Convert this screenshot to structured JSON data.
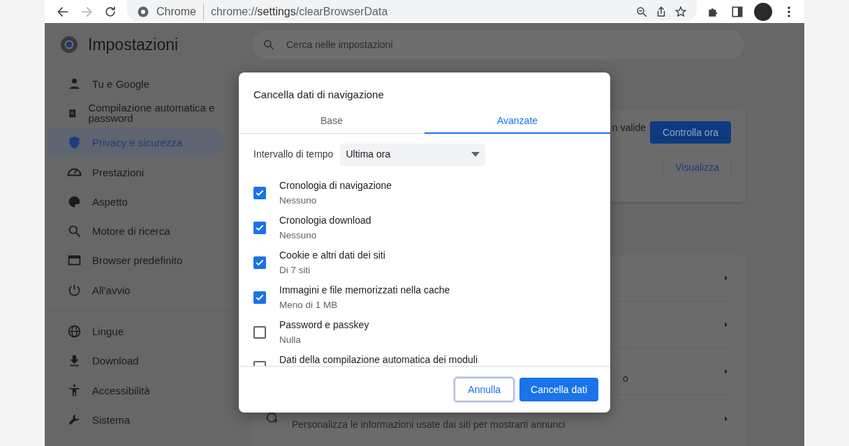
{
  "browser": {
    "site_label": "Chrome",
    "url": "chrome://**settings**/clearBrowserData"
  },
  "header": {
    "title": "Impostazioni",
    "search": {
      "placeholder": "Cerca nelle impostazioni"
    }
  },
  "sidebar": {
    "groups": [
      {
        "items": [
          {
            "label": "Tu e Google",
            "selected": false
          },
          {
            "label": "Compilazione automatica e password",
            "selected": false
          },
          {
            "label": "Privacy e sicurezza",
            "selected": true
          },
          {
            "label": "Prestazioni",
            "selected": false
          },
          {
            "label": "Aspetto",
            "selected": false
          },
          {
            "label": "Motore di ricerca",
            "selected": false
          },
          {
            "label": "Browser predefinito",
            "selected": false
          },
          {
            "label": "All'avvio",
            "selected": false
          }
        ]
      },
      {
        "items": [
          {
            "label": "Lingue",
            "selected": false
          },
          {
            "label": "Download",
            "selected": false
          },
          {
            "label": "Accessibilità",
            "selected": false
          },
          {
            "label": "Sistema",
            "selected": false
          }
        ]
      }
    ]
  },
  "background": {
    "safety_card": {
      "text": "n valide",
      "button": "Controlla ora",
      "link": "Visualizza"
    },
    "privacy_card": {
      "partial_text": "o",
      "last_row_text": "Personalizza le informazioni usate dai siti per mostrarti annunci"
    }
  },
  "dialog": {
    "title": "Cancella dati di navigazione",
    "tabs": [
      {
        "label": "Base",
        "selected": false
      },
      {
        "label": "Avanzate",
        "selected": true
      }
    ],
    "time_range": {
      "label": "Intervallo di tempo",
      "value": "Ultima ora"
    },
    "options": [
      {
        "label": "Cronologia di navigazione",
        "detail": "Nessuno",
        "checked": true
      },
      {
        "label": "Cronologia download",
        "detail": "Nessuno",
        "checked": true
      },
      {
        "label": "Cookie e altri dati dei siti",
        "detail": "Di 7 siti",
        "checked": true
      },
      {
        "label": "Immagini e file memorizzati nella cache",
        "detail": "Meno di 1 MB",
        "checked": true
      },
      {
        "label": "Password e passkey",
        "detail": "Nulla",
        "checked": false
      },
      {
        "label": "Dati della compilazione automatica dei moduli",
        "checked": false
      }
    ],
    "buttons": [
      {
        "label": "Annulla",
        "kind": "secondary"
      },
      {
        "label": "Cancella dati",
        "kind": "primary"
      }
    ]
  }
}
